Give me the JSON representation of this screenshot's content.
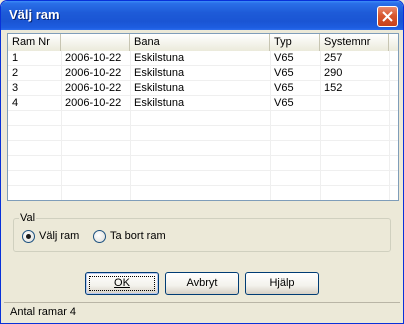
{
  "window": {
    "title": "Välj ram"
  },
  "list": {
    "columns": [
      "Ram Nr",
      "",
      "Bana",
      "Typ",
      "Systemnr"
    ],
    "rows": [
      [
        "1",
        "2006-10-22",
        "Eskilstuna",
        "V65",
        "257"
      ],
      [
        "2",
        "2006-10-22",
        "Eskilstuna",
        "V65",
        "290"
      ],
      [
        "3",
        "2006-10-22",
        "Eskilstuna",
        "V65",
        "152"
      ],
      [
        "4",
        "2006-10-22",
        "Eskilstuna",
        "V65",
        ""
      ]
    ]
  },
  "group": {
    "label": "Val",
    "options": [
      {
        "label": "Välj ram",
        "checked": true
      },
      {
        "label": "Ta bort ram",
        "checked": false
      }
    ]
  },
  "buttons": {
    "ok": "OK",
    "cancel": "Avbryt",
    "help": "Hjälp"
  },
  "status": {
    "text": "Antal ramar 4"
  }
}
